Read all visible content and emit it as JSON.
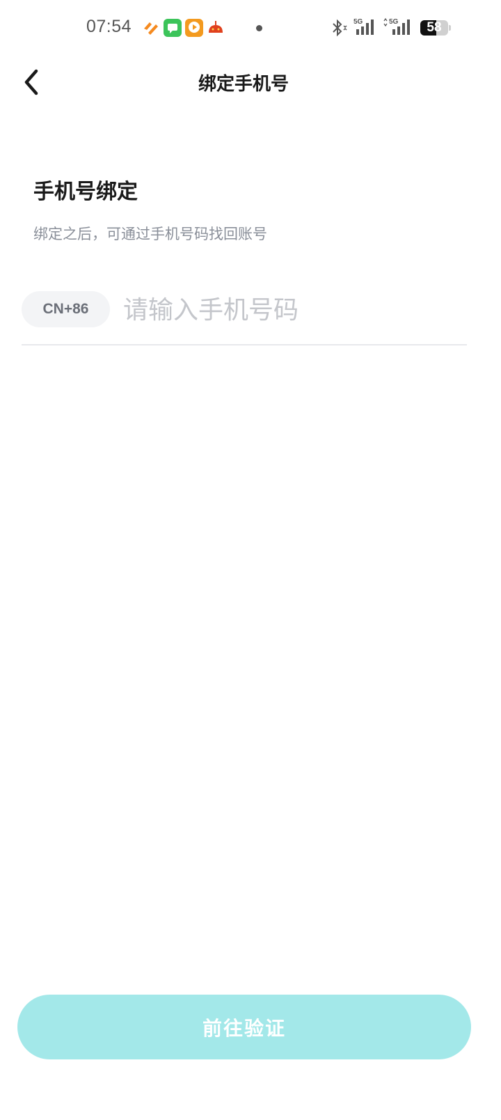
{
  "status_bar": {
    "time": "07:54",
    "network_1": "5G",
    "network_2": "5G",
    "battery_level": "58",
    "battery_percent": 58,
    "icons": [
      "health-app-icon",
      "message-app-icon",
      "video-app-icon",
      "game-app-icon",
      "bluetooth-icon",
      "signal-icon",
      "signal-icon",
      "battery-icon"
    ]
  },
  "nav": {
    "title": "绑定手机号",
    "back_icon": "chevron-left-icon"
  },
  "content": {
    "heading": "手机号绑定",
    "subtitle": "绑定之后，可通过手机号码找回账号",
    "country_code": "CN+86",
    "phone_placeholder": "请输入手机号码",
    "phone_value": ""
  },
  "actions": {
    "submit_label": "前往验证",
    "submit_color": "#a3e8e9"
  }
}
